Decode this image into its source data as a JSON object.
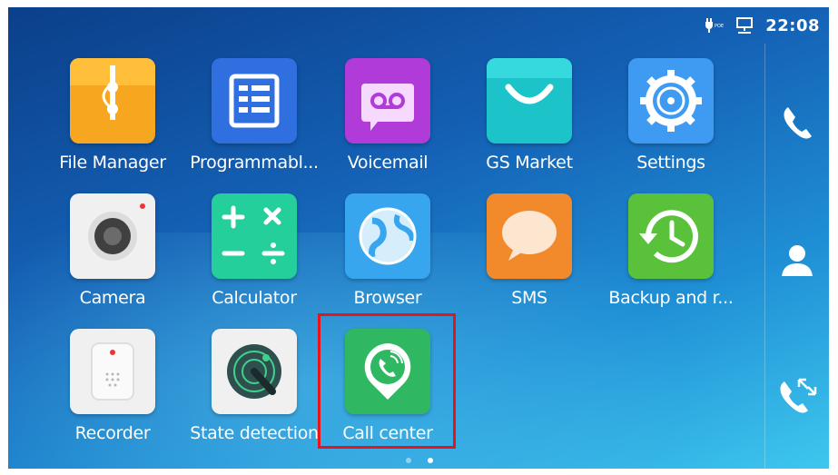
{
  "status_bar": {
    "time": "22:08",
    "icons": [
      "poe-power-icon",
      "network-icon"
    ]
  },
  "apps": [
    {
      "label": "File Manager",
      "icon": "file-manager-icon",
      "color": "#f5a623"
    },
    {
      "label": "Programmabl...",
      "icon": "programmable-keys-icon",
      "color": "#2f6fe0"
    },
    {
      "label": "Voicemail",
      "icon": "voicemail-icon",
      "color": "#b13bd8"
    },
    {
      "label": "GS Market",
      "icon": "gs-market-icon",
      "color": "#1cc3c9"
    },
    {
      "label": "Settings",
      "icon": "settings-icon",
      "color": "#3f9bf2"
    },
    {
      "label": "Camera",
      "icon": "camera-icon",
      "color": "#f0f0f0"
    },
    {
      "label": "Calculator",
      "icon": "calculator-icon",
      "color": "#25cf9c"
    },
    {
      "label": "Browser",
      "icon": "browser-icon",
      "color": "#38a6ee"
    },
    {
      "label": "SMS",
      "icon": "sms-icon",
      "color": "#f28a2b"
    },
    {
      "label": "Backup and r...",
      "icon": "backup-restore-icon",
      "color": "#59c13a"
    },
    {
      "label": "Recorder",
      "icon": "recorder-icon",
      "color": "#f0f0f0"
    },
    {
      "label": "State detection",
      "icon": "state-detection-icon",
      "color": "#f0f0f0"
    },
    {
      "label": "Call center",
      "icon": "call-center-icon",
      "color": "#2fb861"
    }
  ],
  "dock": [
    "phone-icon",
    "contacts-icon",
    "call-history-icon"
  ],
  "pager": {
    "pages": 2,
    "current": 2
  },
  "highlight": {
    "target": "Call center",
    "color": "#e8141c"
  }
}
